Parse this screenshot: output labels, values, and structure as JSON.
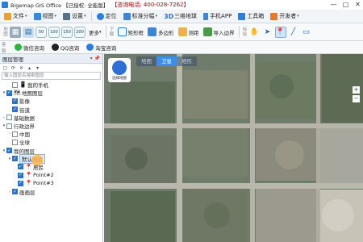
{
  "titlebar": {
    "title": "Bigemap GIS Office 【已授权: 全能版】",
    "hotline": "【咨询电话: 400-028-7262】",
    "minimize": "—",
    "maximize": "□",
    "close": "✕"
  },
  "menubar": {
    "items": [
      {
        "label": "文件",
        "icon": "file-icon",
        "color": "#e9a12f"
      },
      {
        "label": "视图",
        "icon": "view-icon",
        "color": "#3a86d8"
      },
      {
        "label": "设置",
        "icon": "settings-icon",
        "color": "#5a6f86"
      },
      {
        "label": "定位",
        "icon": "location-icon",
        "color": "#2a7de1"
      },
      {
        "label": "标准分幅",
        "icon": "grid-icon",
        "color": "#3a86d8"
      },
      {
        "label": "三维地球",
        "icon": "3d-icon",
        "color": "#2d6fd6"
      },
      {
        "label": "手机APP",
        "icon": "phone-icon",
        "color": "#3a86d8"
      },
      {
        "label": "工具箱",
        "icon": "toolbox-icon",
        "color": "#2a7de1"
      },
      {
        "label": "开发者",
        "icon": "developer-icon",
        "color": "#e57b2e"
      }
    ]
  },
  "toolbar": {
    "side_left": "地图",
    "side_mid": "下载",
    "side_right": "标绘",
    "zoom_levels": [
      "50",
      "100",
      "150",
      "200"
    ],
    "more": "更多",
    "rect_select": "矩形框",
    "polygon": "多边形",
    "measure": "测距",
    "import_boundary": "导入边界"
  },
  "toolbar2": {
    "side": "客服",
    "buttons": [
      "微信咨询",
      "QQ咨询",
      "淘宝咨询"
    ]
  },
  "panel": {
    "title": "图层管理",
    "pin": "▾ 📌",
    "search_placeholder": "输入图层名搜索图层",
    "tree": [
      {
        "label": "我的手机",
        "level": 1,
        "expander": "",
        "checked": false,
        "icon": "📱"
      },
      {
        "label": "地图图层",
        "level": 0,
        "expander": "▾",
        "checked": true,
        "icon": "🗺"
      },
      {
        "label": "影像",
        "level": 1,
        "expander": "",
        "checked": true,
        "icon": ""
      },
      {
        "label": "街道",
        "level": 1,
        "expander": "",
        "checked": true,
        "icon": ""
      },
      {
        "label": "基础数据",
        "level": 0,
        "expander": "›",
        "checked": false,
        "icon": ""
      },
      {
        "label": "行政边界",
        "level": 0,
        "expander": "▾",
        "checked": false,
        "icon": ""
      },
      {
        "label": "中国",
        "level": 1,
        "expander": "›",
        "checked": false,
        "icon": ""
      },
      {
        "label": "全球",
        "level": 1,
        "expander": "",
        "checked": false,
        "icon": ""
      },
      {
        "label": "我的图层",
        "level": 0,
        "expander": "▾",
        "checked": true,
        "icon": ""
      },
      {
        "label": "默认图层",
        "level": 1,
        "expander": "▾",
        "checked": true,
        "icon": "",
        "selected": true
      },
      {
        "label": "居民",
        "level": 2,
        "expander": "",
        "checked": true,
        "icon": "📍"
      },
      {
        "label": "Point#2",
        "level": 2,
        "expander": "",
        "checked": true,
        "icon": "📍"
      },
      {
        "label": "Point#3",
        "level": 2,
        "expander": "",
        "checked": true,
        "icon": "📍"
      },
      {
        "label": "画画层",
        "level": 1,
        "expander": "›",
        "checked": true,
        "icon": ""
      }
    ]
  },
  "map": {
    "tabs": [
      "地图",
      "卫星",
      "地形"
    ],
    "active_tab": "卫星",
    "logo_text": "选择地图"
  },
  "colors": {
    "accent": "#2b72c9",
    "hotline": "#b00000",
    "active_tab": "#3d8ee8"
  }
}
